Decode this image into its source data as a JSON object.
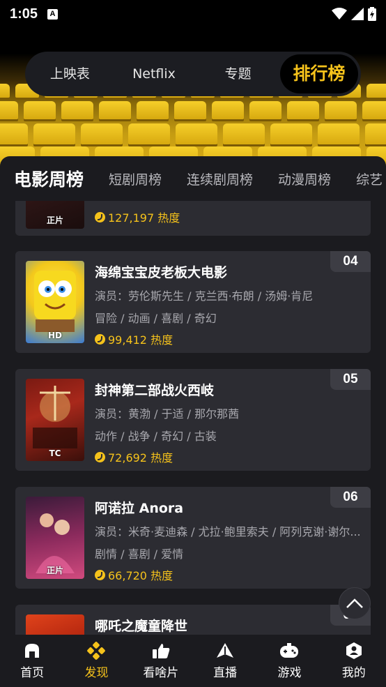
{
  "status": {
    "time": "1:05"
  },
  "top_tabs": [
    {
      "label": "上映表"
    },
    {
      "label": "Netflix"
    },
    {
      "label": "专题"
    },
    {
      "label": "排行榜",
      "active": true
    }
  ],
  "category_tabs": [
    {
      "label": "电影周榜",
      "active": true
    },
    {
      "label": "短剧周榜"
    },
    {
      "label": "连续剧周榜"
    },
    {
      "label": "动漫周榜"
    },
    {
      "label": "综艺"
    }
  ],
  "movies": [
    {
      "rank": "",
      "title": "",
      "cast": "",
      "genres": "",
      "heat": "127,197 热度",
      "poster_label": "正片"
    },
    {
      "rank": "04",
      "title": "海绵宝宝皮老板大电影",
      "cast": "演员：劳伦斯先生 / 克兰西·布朗 / 汤姆·肯尼",
      "genres": "冒险 / 动画 / 喜剧 / 奇幻",
      "heat": "99,412 热度",
      "poster_label": "HD"
    },
    {
      "rank": "05",
      "title": "封神第二部战火西岐",
      "cast": "演员：黄渤 / 于适 / 那尔那茜",
      "genres": "动作 / 战争 / 奇幻 / 古装",
      "heat": "72,692 热度",
      "poster_label": "TC"
    },
    {
      "rank": "06",
      "title": "阿诺拉 Anora",
      "cast": "演员：米奇·麦迪森 / 尤拉·鲍里索夫 / 阿列克谢·谢尔...",
      "genres": "剧情 / 喜剧 / 爱情",
      "heat": "66,720 热度",
      "poster_label": "正片"
    },
    {
      "rank": "07",
      "title": "哪吒之魔童降世",
      "cast": "",
      "genres": "",
      "heat": "",
      "poster_label": ""
    }
  ],
  "bottom_nav": [
    {
      "label": "首页",
      "icon": "home-icon"
    },
    {
      "label": "发现",
      "icon": "discover-icon",
      "active": true
    },
    {
      "label": "看啥片",
      "icon": "thumbs-up-icon"
    },
    {
      "label": "直播",
      "icon": "live-icon"
    },
    {
      "label": "游戏",
      "icon": "gamepad-icon"
    },
    {
      "label": "我的",
      "icon": "profile-icon"
    }
  ],
  "colors": {
    "accent": "#f5c21b",
    "panel": "#1b1b1f",
    "card": "#2c2c32"
  }
}
